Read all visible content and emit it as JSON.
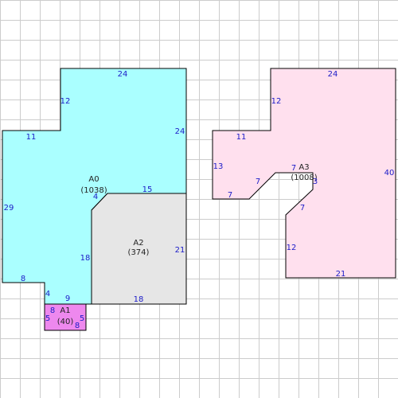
{
  "colors": {
    "grid": "#cccccc",
    "outline": "#000000",
    "a0_fill": "#aaffff",
    "a1_fill": "#ee88ee",
    "a2_fill": "#e6e6e6",
    "a3_fill": "#ffe0ee",
    "dimension_text": "#1c1cc8"
  },
  "areas": {
    "a0": {
      "name": "A0",
      "value": "(1038)"
    },
    "a1": {
      "name": "A1",
      "value": "(40)"
    },
    "a2": {
      "name": "A2",
      "value": "(374)"
    },
    "a3": {
      "name": "A3",
      "value": "(1008)"
    }
  },
  "dims": {
    "a0_top": "24",
    "a0_step_vertical": "12",
    "a0_step_horizontal": "11",
    "a0_right": "24",
    "a0_left": "29",
    "a0_bottom_left": "8",
    "a0_notch_vertical": "4",
    "a0_notch_horizontal": "9",
    "a0_inner_vertical": "18",
    "a0_inner_chamfer": "4",
    "a2_top": "15",
    "a2_right": "21",
    "a2_bottom": "18",
    "a1_top": "8",
    "a1_left": "5",
    "a1_right": "5",
    "a1_bottom": "8",
    "a3_top": "24",
    "a3_step_vertical": "12",
    "a3_step_horizontal": "11",
    "a3_left": "13",
    "a3_left_bottom": "7",
    "a3_diagonal_lower": "7",
    "a3_notch_top": "7",
    "a3_notch_right": "3",
    "a3_diagonal_right": "7",
    "a3_inner_vertical": "12",
    "a3_bottom": "21",
    "a3_right": "40"
  }
}
